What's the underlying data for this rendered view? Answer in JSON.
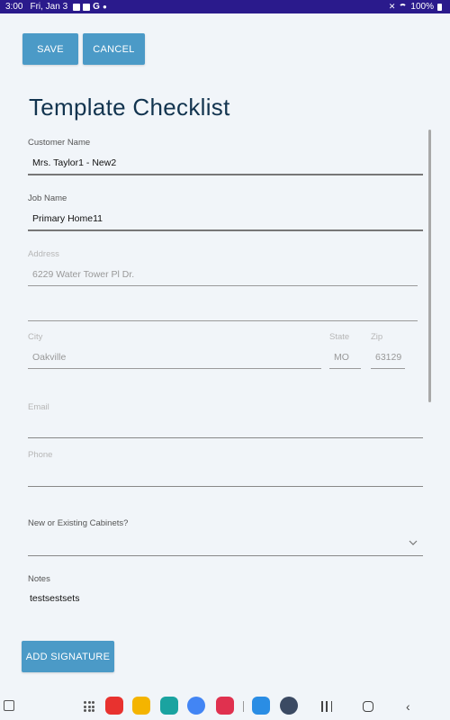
{
  "status_bar": {
    "time": "3:00",
    "date": "Fri, Jan 3",
    "battery": "100%"
  },
  "toolbar": {
    "save_label": "SAVE",
    "cancel_label": "CANCEL"
  },
  "page": {
    "title": "Template Checklist"
  },
  "form": {
    "customer_name": {
      "label": "Customer Name",
      "value": "Mrs. Taylor1 - New2"
    },
    "job_name": {
      "label": "Job Name",
      "value": "Primary Home11"
    },
    "address": {
      "label": "Address",
      "value": "6229 Water Tower Pl Dr.",
      "value2": ""
    },
    "city": {
      "label": "City",
      "value": "Oakville"
    },
    "state": {
      "label": "State",
      "value": "MO"
    },
    "zip": {
      "label": "Zip",
      "value": "63129"
    },
    "email": {
      "label": "Email",
      "value": ""
    },
    "phone": {
      "label": "Phone",
      "value": ""
    },
    "cabinets": {
      "label": "New or Existing Cabinets?",
      "value": ""
    },
    "notes": {
      "label": "Notes",
      "value": "testsestsets"
    }
  },
  "actions": {
    "add_signature_label": "ADD SIGNATURE"
  },
  "nav_bar": {
    "apps": [
      {
        "name": "flipboard",
        "color": "#e8322f"
      },
      {
        "name": "files",
        "color": "#f4b400"
      },
      {
        "name": "calendar",
        "color": "#1aa3a0"
      },
      {
        "name": "chrome",
        "color": "#4285f4"
      },
      {
        "name": "screen-recorder",
        "color": "#e0314f"
      },
      {
        "name": "connect",
        "color": "#2a8de4"
      },
      {
        "name": "settings",
        "color": "#3b4a63"
      }
    ]
  }
}
